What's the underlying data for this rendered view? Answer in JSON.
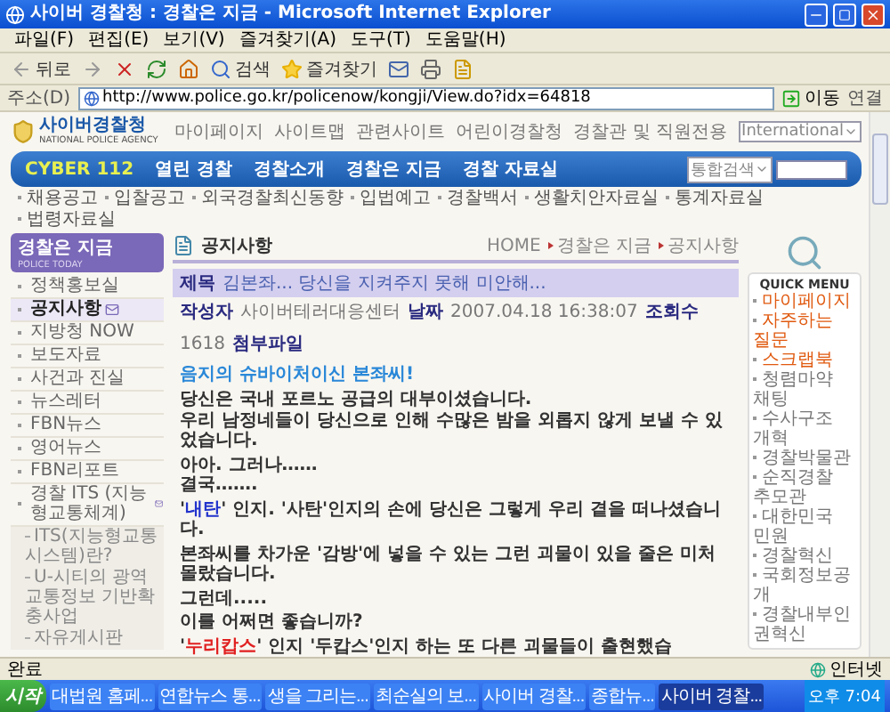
{
  "window": {
    "title": "사이버 경찰청 : 경찰은 지금 - Microsoft Internet Explorer"
  },
  "menu": [
    "파일(F)",
    "편집(E)",
    "보기(V)",
    "즐겨찾기(A)",
    "도구(T)",
    "도움말(H)"
  ],
  "toolbar": {
    "back": "뒤로",
    "search": "검색",
    "favorites": "즐겨찾기"
  },
  "address_bar": {
    "label": "주소(D)",
    "url": "http://www.police.go.kr/policenow/kongji/View.do?idx=64818",
    "go": "이동",
    "links": "연결"
  },
  "site": {
    "logo": "사이버경찰청",
    "logo_sub": "NATIONAL POLICE AGENCY",
    "top_links": [
      "마이페이지",
      "사이트맵",
      "관련사이트",
      "어린이경찰청",
      "경찰관 및 직원전용"
    ],
    "language_select": "International",
    "nav": [
      {
        "label": "CYBER 112",
        "kind": "brand"
      },
      {
        "label": "열린 경찰",
        "kind": "link"
      },
      {
        "label": "경찰소개",
        "kind": "link"
      },
      {
        "label": "경찰은 지금",
        "kind": "link"
      },
      {
        "label": "경찰 자료실",
        "kind": "link"
      }
    ],
    "search_select": "통합검색",
    "sub_nav": [
      "채용공고",
      "입찰공고",
      "외국경찰최신동향",
      "입법예고",
      "경찰백서",
      "생활치안자료실",
      "통계자료실",
      "법령자료실"
    ]
  },
  "sidebar": {
    "title": "경찰은 지금",
    "title_sub": "POLICE TODAY",
    "items": [
      {
        "label": "정책홍보실",
        "selected": false,
        "badge": false
      },
      {
        "label": "공지사항",
        "selected": true,
        "badge": true
      },
      {
        "label": "지방청 NOW",
        "selected": false,
        "badge": false
      },
      {
        "label": "보도자료",
        "selected": false,
        "badge": false
      },
      {
        "label": "사건과 진실",
        "selected": false,
        "badge": false
      },
      {
        "label": "뉴스레터",
        "selected": false,
        "badge": false
      },
      {
        "label": "FBN뉴스",
        "selected": false,
        "badge": false
      },
      {
        "label": "영어뉴스",
        "selected": false,
        "badge": false
      },
      {
        "label": "FBN리포트",
        "selected": false,
        "badge": false
      },
      {
        "label": "경찰 ITS (지능형교통체계)",
        "selected": false,
        "badge": true,
        "children": [
          {
            "label": "ITS(지능형교통시스템)란?"
          },
          {
            "label": "U-시티의 광역교통정보 기반확충사업"
          },
          {
            "label": "자유게시판"
          }
        ]
      }
    ]
  },
  "main": {
    "title": "공지사항",
    "breadcrumb": [
      "HOME",
      "경찰은 지금",
      "공지사항"
    ],
    "post": {
      "subject_label": "제목",
      "subject": "김본좌... 당신을 지켜주지 못해 미안해...",
      "author_label": "작성자",
      "author": "사이버테러대응센터",
      "date_label": "날짜",
      "date": "2007.04.18 16:38:07",
      "views_label": "조회수",
      "views": "1618",
      "attachment_label": "첨부파일"
    },
    "heading": "음지의 슈바이처이신 본좌씨!",
    "paragraphs": [
      {
        "lines": [
          [
            {
              "text": "당신은 국내 포르노 공급의 대부이셨습니다."
            }
          ],
          [
            {
              "text": "우리 남정네들이 당신으로 인해 수많은 밤을 외롭지 않게 보낼 수 있었습니다."
            }
          ]
        ]
      },
      {
        "lines": [
          [
            {
              "text": "아아. 그러나……"
            }
          ],
          [
            {
              "text": "결국……."
            }
          ]
        ]
      },
      {
        "lines": [
          [
            {
              "text": "'"
            },
            {
              "text": "내탄",
              "color": "#2233cc"
            },
            {
              "text": "' 인지. '사탄'인지의 손에 당신은 그렇게 우리 곁을 떠나셨습니다."
            }
          ]
        ]
      },
      {
        "lines": [
          [
            {
              "text": "본좌씨를 차가운 '감방'에 넣을 수 있는 그런 괴물이 있을 줄은 미처 몰랐습니다."
            }
          ]
        ]
      },
      {
        "lines": [
          [
            {
              "text": "그런데....."
            }
          ]
        ]
      },
      {
        "lines": [
          [
            {
              "text": "이를 어쩌면 좋습니까?"
            }
          ]
        ]
      },
      {
        "lines": [
          [
            {
              "text": "'"
            },
            {
              "text": "누리캅스",
              "color": "#e02020"
            },
            {
              "text": "' 인지 '두캅스'인지 하는 또 다른 괴물들이 출현했습"
            }
          ]
        ]
      }
    ]
  },
  "quick_menu": {
    "title": "QUICK MENU",
    "items": [
      {
        "label": "마이페이지",
        "kind": "primary"
      },
      {
        "label": "자주하는 질문",
        "kind": "primary"
      },
      {
        "label": "스크랩북",
        "kind": "primary"
      },
      {
        "label": "청렴마약 채팅",
        "kind": "secondary"
      },
      {
        "label": "수사구조 개혁",
        "kind": "secondary"
      },
      {
        "label": "경찰박물관",
        "kind": "secondary"
      },
      {
        "label": "순직경찰 추모관",
        "kind": "secondary"
      },
      {
        "label": "대한민국 민원",
        "kind": "secondary"
      },
      {
        "label": "경찰혁신",
        "kind": "secondary"
      },
      {
        "label": "국회정보공개",
        "kind": "secondary"
      },
      {
        "label": "경찰내부인권혁신",
        "kind": "secondary"
      }
    ]
  },
  "status_bar": {
    "text": "완료",
    "zone": "인터넷"
  },
  "taskbar": {
    "start": "시작",
    "tasks": [
      {
        "label": "대법원 홈페...",
        "selected": false
      },
      {
        "label": "연합뉴스 통...",
        "selected": false
      },
      {
        "label": "생을 그리는...",
        "selected": false
      },
      {
        "label": "최순실의 보...",
        "selected": false
      },
      {
        "label": "사이버 경찰...",
        "selected": false
      },
      {
        "label": "종합뉴...",
        "selected": false
      },
      {
        "label": "사이버 경찰...",
        "selected": true
      }
    ],
    "clock": "오후 7:04"
  }
}
